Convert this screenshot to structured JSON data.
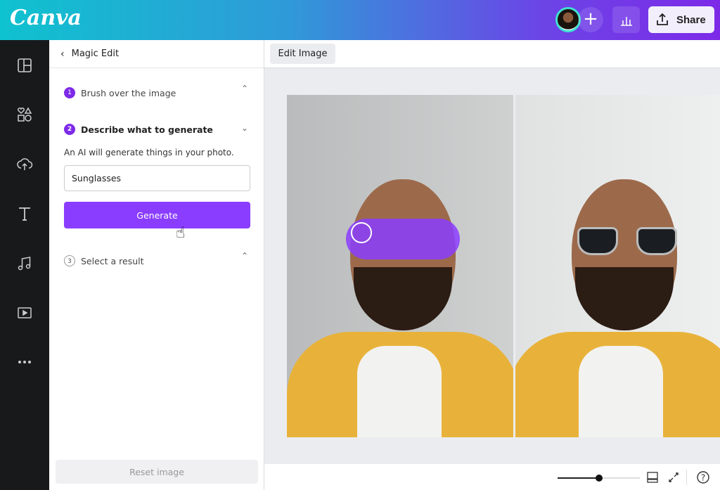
{
  "header": {
    "logo": "Canva",
    "share_label": "Share",
    "add_icon": "plus-icon",
    "stats_icon": "bar-chart-icon",
    "share_icon": "upload-icon"
  },
  "rail": {
    "items": [
      "layout-icon",
      "elements-icon",
      "uploads-icon",
      "text-icon",
      "audio-icon",
      "video-icon",
      "more-icon"
    ]
  },
  "panel": {
    "title": "Magic Edit",
    "steps": [
      {
        "num": "1",
        "label": "Brush over the image",
        "expanded": false
      },
      {
        "num": "2",
        "label": "Describe what to generate",
        "expanded": true
      },
      {
        "num": "3",
        "label": "Select a result",
        "expanded": false
      }
    ],
    "description": "An AI will generate things in your photo.",
    "prompt_value": "Sunglasses",
    "generate_label": "Generate",
    "reset_label": "Reset image"
  },
  "toolbar": {
    "edit_image_label": "Edit Image"
  },
  "footer": {
    "zoom_fraction": 0.5
  },
  "colors": {
    "accent": "#8b3dff",
    "step_badge": "#7d2ae8",
    "rail": "#18191b"
  }
}
